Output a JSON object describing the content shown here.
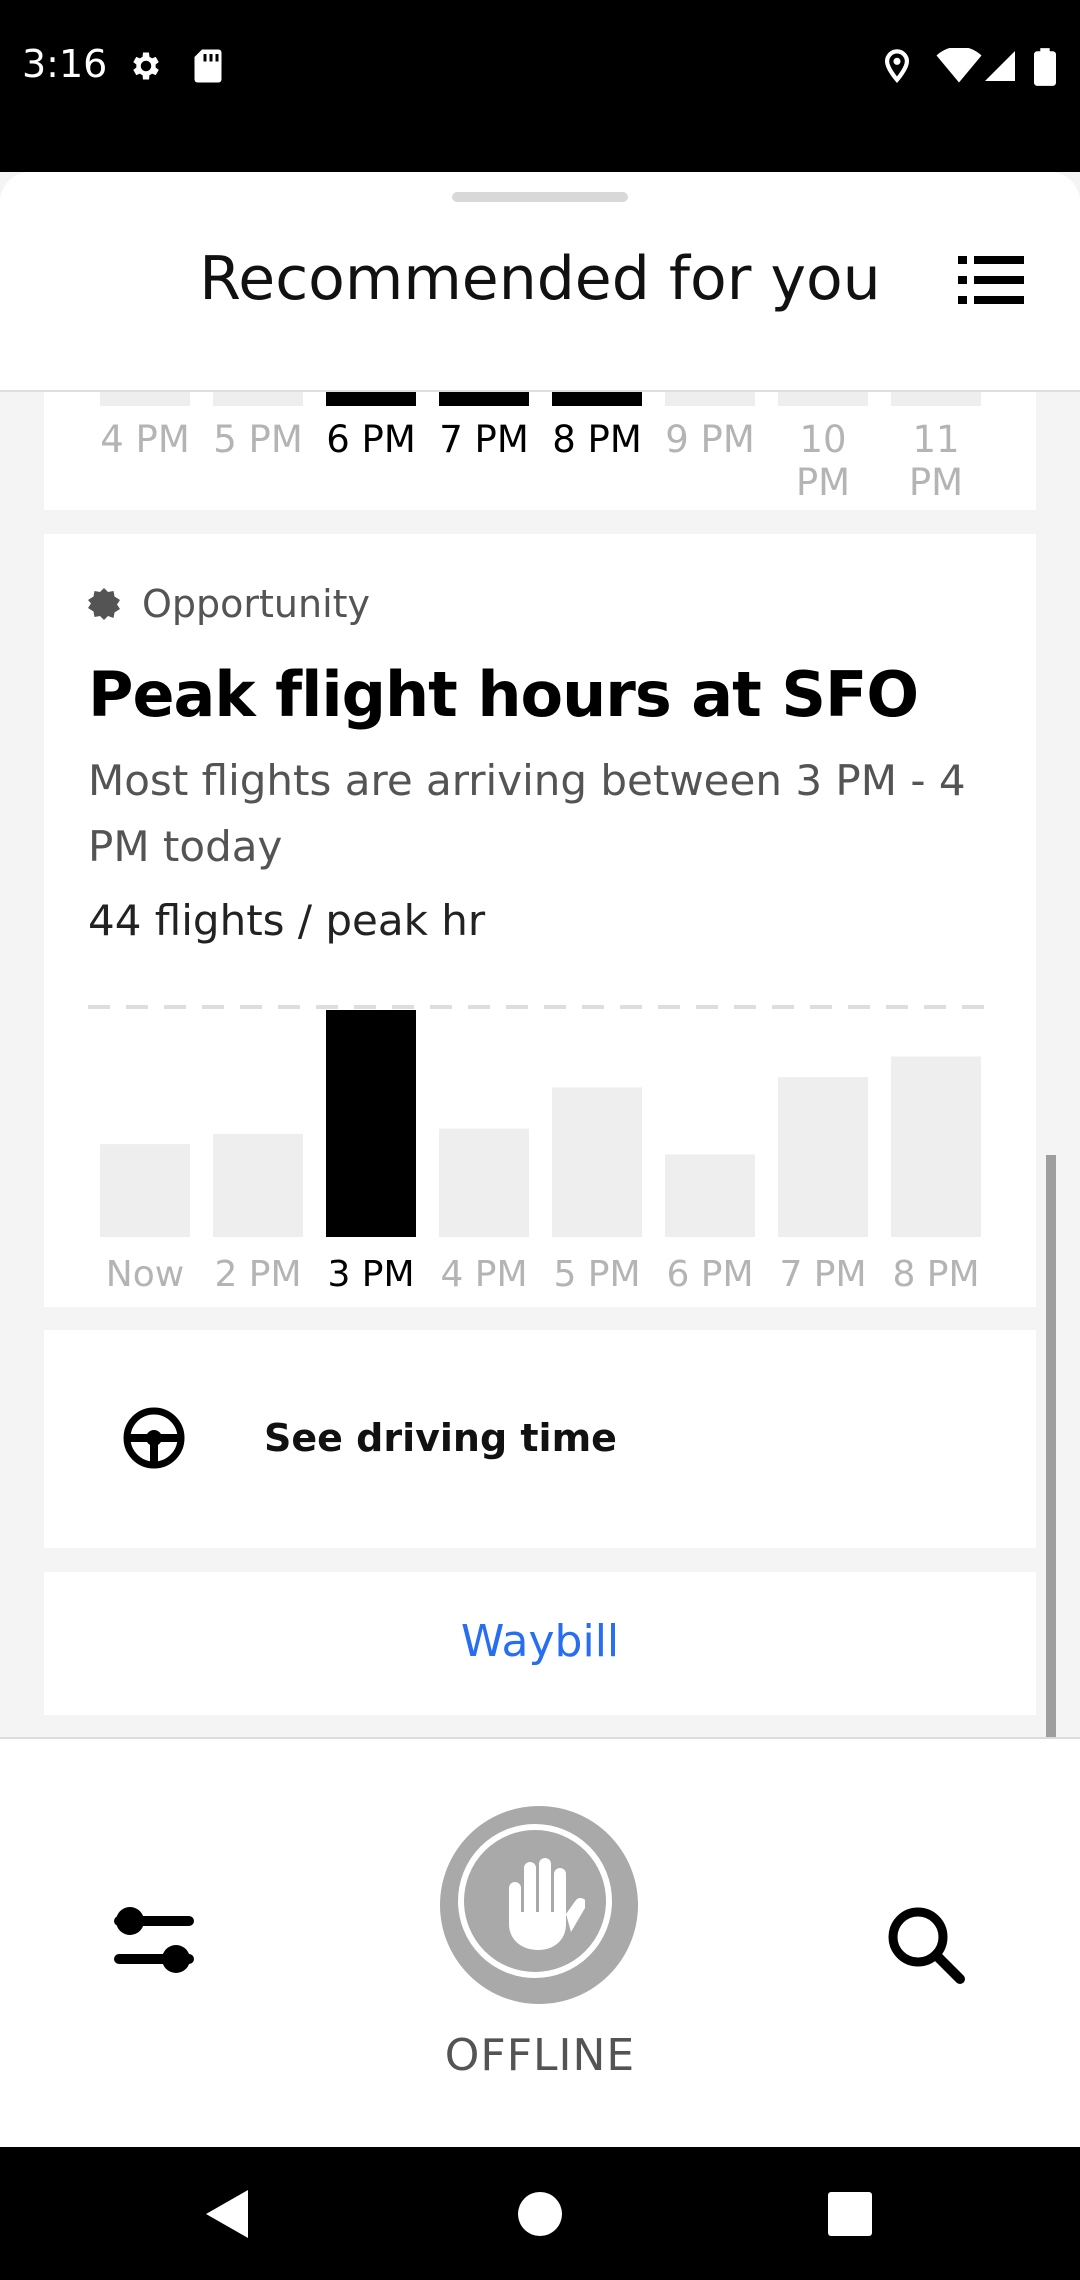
{
  "status_bar": {
    "time": "3:16",
    "left_icons": [
      "gear-icon",
      "sd-card-icon"
    ],
    "right_icons": [
      "location-pin-icon",
      "wifi-icon",
      "signal-icon",
      "battery-icon"
    ]
  },
  "header": {
    "title": "Recommended for you",
    "menu_icon": "list-icon"
  },
  "hourly_card": {
    "ticks": [
      {
        "label": "4 PM",
        "active": false
      },
      {
        "label": "5 PM",
        "active": false
      },
      {
        "label": "6 PM",
        "active": true
      },
      {
        "label": "7 PM",
        "active": true
      },
      {
        "label": "8 PM",
        "active": true
      },
      {
        "label": "9 PM",
        "active": false
      },
      {
        "label": "10 PM",
        "active": false
      },
      {
        "label": "11 PM",
        "active": false
      }
    ]
  },
  "opportunity": {
    "badge_icon": "badge-icon",
    "label": "Opportunity",
    "title": "Peak flight hours at SFO",
    "description": "Most flights are arriving between 3 PM - 4 PM today",
    "peak_text": "44 flights / peak hr"
  },
  "chart_data": {
    "type": "bar",
    "categories": [
      "Now",
      "2 PM",
      "3 PM",
      "4 PM",
      "5 PM",
      "6 PM",
      "7 PM",
      "8 PM"
    ],
    "values": [
      18,
      20,
      44,
      21,
      29,
      16,
      31,
      35
    ],
    "highlight": "3 PM",
    "reference_line": 44,
    "colors": {
      "bar": "#eeeeee",
      "highlight": "#000000",
      "tick": "#b4b4b4",
      "tick_active": "#000000",
      "reference_line": "#dddddd"
    }
  },
  "driving": {
    "icon": "steering-wheel-icon",
    "label": "See driving time"
  },
  "waybill": {
    "label": "Waybill",
    "color": "#276ef1"
  },
  "bottom_bar": {
    "left_icon": "preferences-icon",
    "center_icon": "hand-stop-icon",
    "status_label": "OFFLINE",
    "right_icon": "search-icon"
  },
  "nav_bar": {
    "icons": [
      "back-icon",
      "home-icon",
      "recents-icon"
    ]
  }
}
